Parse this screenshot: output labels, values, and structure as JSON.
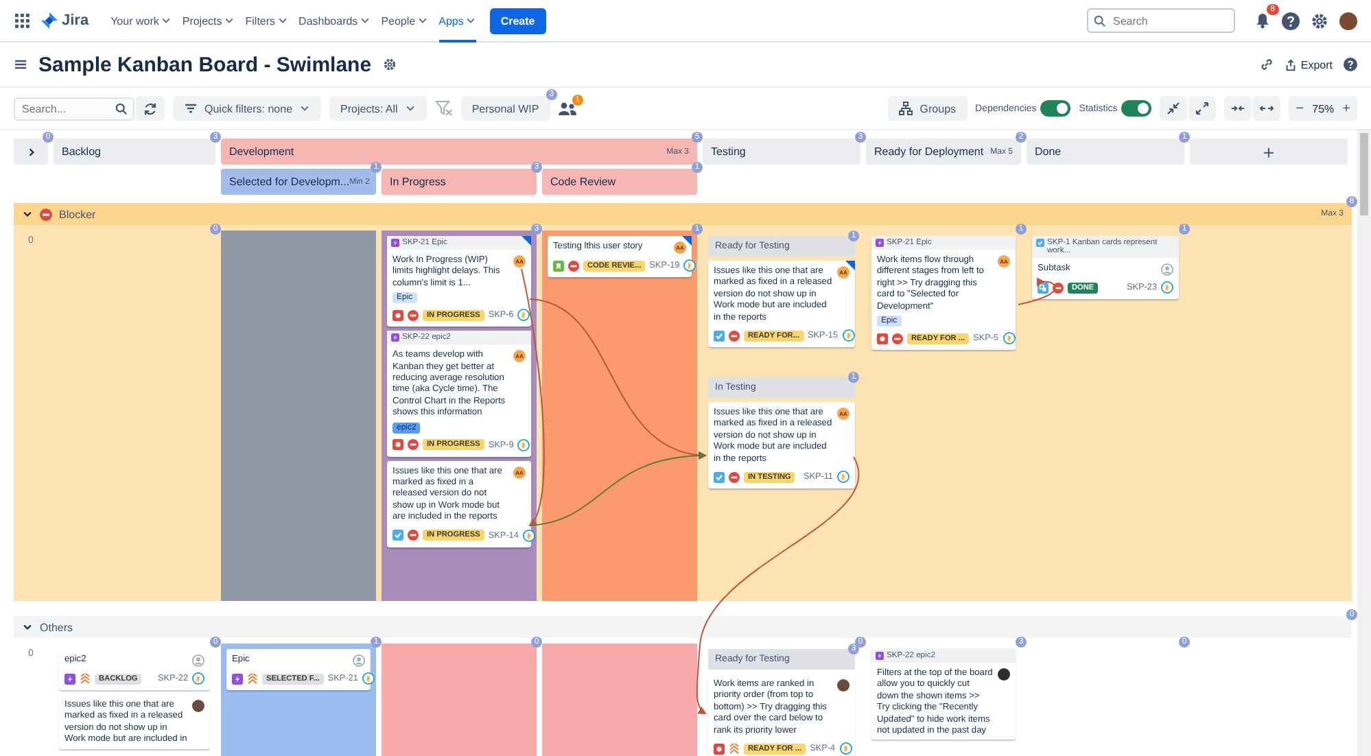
{
  "nav": {
    "logo": "Jira",
    "menu": [
      {
        "label": "Your work",
        "selected": false
      },
      {
        "label": "Projects",
        "selected": false
      },
      {
        "label": "Filters",
        "selected": false
      },
      {
        "label": "Dashboards",
        "selected": false
      },
      {
        "label": "People",
        "selected": false
      },
      {
        "label": "Apps",
        "selected": true
      }
    ],
    "create": "Create",
    "search": {
      "placeholder": "Search"
    },
    "notifications": "8"
  },
  "board": {
    "title": "Sample Kanban Board - Swimlane",
    "export": "Export"
  },
  "toolbar": {
    "search": {
      "placeholder": "Search..."
    },
    "quick_filters": "Quick filters: none",
    "projects": "Projects: All",
    "personal_wip": "Personal WIP",
    "personal_wip_count": "3",
    "people_count": "1",
    "groups": "Groups",
    "toggles": [
      {
        "label": "Dependencies",
        "on": true
      },
      {
        "label": "Statistics",
        "on": true
      }
    ],
    "zoom_out": "−",
    "zoom": "75%",
    "zoom_in": "+"
  },
  "header": {
    "expand_count": "0",
    "add_column": "+",
    "columns": [
      {
        "title": "Backlog",
        "count": "3"
      },
      {
        "title": "Development",
        "count": "5",
        "limit": "Max 3",
        "color": "#f5b6b4",
        "sub": [
          {
            "title": "Selected for Developm...",
            "limit": "Min 2",
            "count": "1",
            "color": "#a3bce9"
          },
          {
            "title": "In Progress",
            "count": "3",
            "color": "#f5b6b4"
          },
          {
            "title": "Code Review",
            "count": "1",
            "color": "#f5b6b4"
          }
        ]
      },
      {
        "title": "Testing",
        "count": "3"
      },
      {
        "title": "Ready for Deployment",
        "limit": "Max 5",
        "count": "2"
      },
      {
        "title": "Done",
        "count": "1"
      }
    ]
  },
  "lanes": [
    {
      "title": "Blocker",
      "kind": "blocker",
      "expanded": true,
      "limit": "Max 3",
      "count": "8",
      "row_count": "0",
      "cells": [
        {
          "count": "0"
        },
        {
          "color": "#8f9aa6"
        },
        {
          "count": "3",
          "color": "#a98cba",
          "cards": [
            {
              "epic": {
                "text": "SKP-21 Epic",
                "kind": "epic"
              },
              "summary": "Work In Progress (WIP) limits highlight delays. This column's limit is 1...",
              "avatar": {
                "kind": "initials",
                "text": "AA"
              },
              "label": {
                "text": "Epic",
                "color": "#cfe1fd"
              },
              "kind": "bug",
              "blocker": true,
              "status": {
                "text": "IN PROGRESS",
                "color": "#f8d66d"
              },
              "key": "SKP-6",
              "flagged": true
            },
            {
              "epic": {
                "text": "SKP-22 epic2",
                "kind": "epic"
              },
              "summary": "As teams develop with Kanban they get better at reducing average resolution time (aka Cycle time). The Control Chart in the Reports shows this information",
              "avatar": {
                "kind": "initials",
                "text": "AA"
              },
              "label": {
                "text": "epic2",
                "color": "#579dff"
              },
              "kind": "bug",
              "blocker": true,
              "status": {
                "text": "IN PROGRESS",
                "color": "#f8d66d"
              },
              "key": "SKP-9",
              "flagged": false
            },
            {
              "summary": "Issues like this one that are marked as fixed in a released version do not show up in Work mode but are included in the reports",
              "avatar": {
                "kind": "initials",
                "text": "AA"
              },
              "kind": "task",
              "blocker": true,
              "status": {
                "text": "IN PROGRESS",
                "color": "#f8d66d"
              },
              "key": "SKP-14",
              "flagged": false
            }
          ]
        },
        {
          "count": "1",
          "color": "#fa9a6d",
          "cards": [
            {
              "summary": "Testing lthis user story",
              "avatar": {
                "kind": "initials",
                "text": "AA"
              },
              "kind": "story",
              "blocker": true,
              "status": {
                "text": "CODE REVIE...",
                "color": "#f8d66d"
              },
              "key": "SKP-19",
              "flagged": true
            }
          ]
        },
        {
          "sections": [
            {
              "title": "Ready for Testing",
              "count": "1",
              "cards": [
                {
                  "summary": "Issues like this one that are marked as fixed in a released version do not show up in Work mode but are included in the reports",
                  "avatar": {
                    "kind": "initials",
                    "text": "AA"
                  },
                  "kind": "task",
                  "blocker": true,
                  "status": {
                    "text": "READY FOR...",
                    "color": "#f8d66d"
                  },
                  "key": "SKP-15",
                  "flagged": true
                }
              ]
            },
            {
              "title": "In Testing",
              "count": "1",
              "cards": [
                {
                  "summary": "Issues like this one that are marked as fixed in a released version do not show up in Work mode but are included in the reports",
                  "avatar": {
                    "kind": "initials",
                    "text": "AA"
                  },
                  "kind": "task",
                  "blocker": true,
                  "status": {
                    "text": "IN TESTING",
                    "color": "#f8d66d"
                  },
                  "key": "SKP-11",
                  "flagged": false
                }
              ]
            }
          ]
        },
        {
          "count": "1",
          "cards": [
            {
              "epic": {
                "text": "SKP-21 Epic",
                "kind": "epic"
              },
              "summary": "Work items flow through different stages from left to right >> Try dragging this card to \"Selected for Development\"",
              "avatar": {
                "kind": "initials",
                "text": "AA"
              },
              "label": {
                "text": "Epic",
                "color": "#cfe1fd"
              },
              "kind": "bug",
              "blocker": true,
              "status": {
                "text": "READY FOR ...",
                "color": "#f8d66d"
              },
              "key": "SKP-5",
              "flagged": false
            }
          ]
        },
        {
          "count": "1",
          "cards": [
            {
              "epic": {
                "text": "SKP-1 Kanban cards represent work...",
                "kind": "task"
              },
              "summary": "Subtask",
              "avatar": {
                "kind": "unassigned"
              },
              "kind": "subtask",
              "blocker": true,
              "status": {
                "text": "DONE",
                "color": "#1f845a"
              },
              "key": "SKP-23",
              "flagged": false
            }
          ]
        }
      ]
    },
    {
      "title": "Others",
      "kind": "normal",
      "expanded": true,
      "count": "0",
      "row_count": "0",
      "cells": [
        {
          "count": "0",
          "cards": [
            {
              "summary": "epic2",
              "avatar": {
                "kind": "unassigned"
              },
              "kind": "epic",
              "blocker": false,
              "status": {
                "text": "BACKLOG",
                "color": "#dcdfe4"
              },
              "key": "SKP-22",
              "flagged": false
            },
            {
              "summary": "Issues like this one that are marked as fixed in a released version do not show up in Work mode but are included in",
              "avatar": {
                "kind": "photo",
                "color": "#6b4a3a"
              },
              "flagged": false
            }
          ]
        },
        {
          "count": "1",
          "color": "#9dbcf0",
          "cards": [
            {
              "summary": "Epic",
              "avatar": {
                "kind": "unassigned"
              },
              "kind": "epic",
              "blocker": false,
              "status": {
                "text": "SELECTED F...",
                "color": "#dcdfe4"
              },
              "key": "SKP-21",
              "flagged": false
            }
          ]
        },
        {
          "count": "0",
          "color": "#f8aaaa"
        },
        {
          "color": "#f8aaaa"
        },
        {
          "count": "0",
          "sections": [
            {
              "title": "Ready for Testing",
              "count": "3",
              "cards": [
                {
                  "summary": "Work items are ranked in priority order (from top to bottom) >> Try dragging this card over the card below to rank its priority lower",
                  "avatar": {
                    "kind": "photo",
                    "color": "#6b4a3a"
                  },
                  "kind": "bug",
                  "blocker": false,
                  "status": {
                    "text": "READY FOR ...",
                    "color": "#f8d66d"
                  },
                  "key": "SKP-4",
                  "flagged": false
                }
              ]
            }
          ]
        },
        {
          "count": "3",
          "cards": [
            {
              "epic": {
                "text": "SKP-22 epic2",
                "kind": "epic"
              },
              "summary": "Filters at the top of the board allow you to quickly cut down the shown items >> Try clicking the \"Recently Updated\" to hide work items not updated in the past day",
              "avatar": {
                "kind": "photo",
                "color": "#2d2d2d"
              },
              "flagged": false
            }
          ]
        },
        {
          "count": "0"
        }
      ]
    }
  ]
}
